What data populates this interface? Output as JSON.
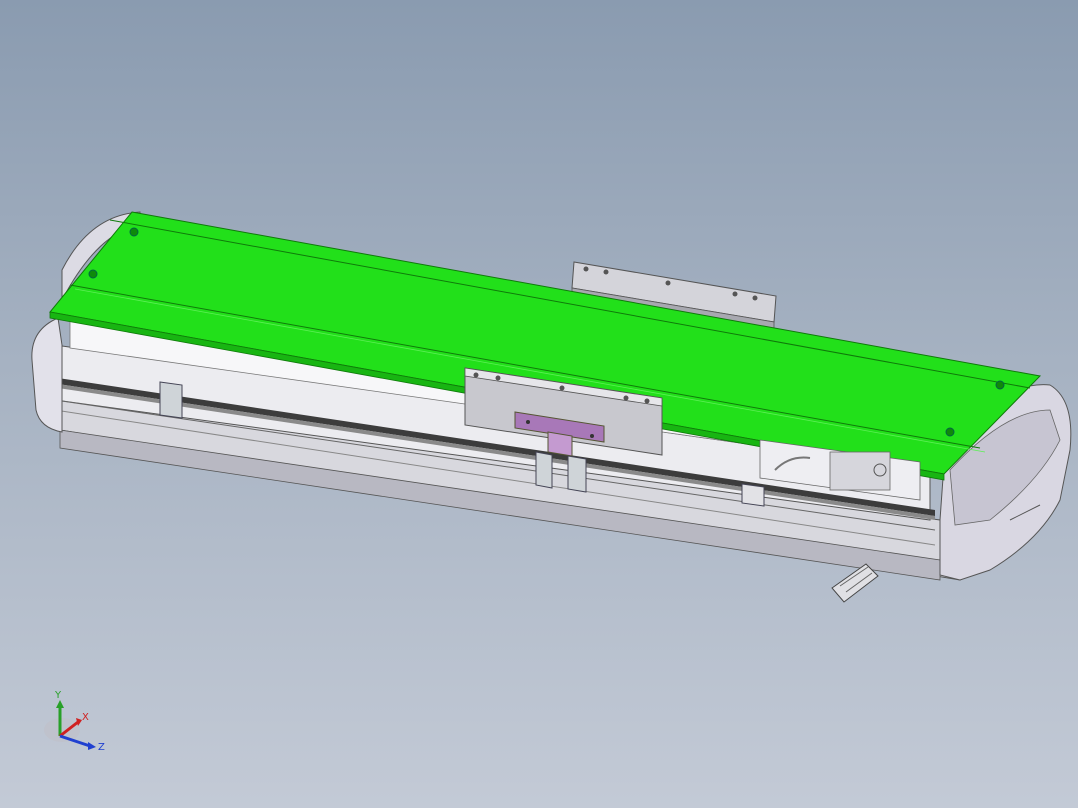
{
  "viewport": {
    "model_colors": {
      "top_cover": "#22e01a",
      "top_cover_edge": "#0f7a0a",
      "body": "#e4e4ea",
      "body_shadow": "#b4b4be",
      "end_cap": "#dedde6",
      "carriage": "#c9c9cf",
      "bracket": "#a878b8",
      "rail": "#3a3a3a"
    }
  },
  "triad": {
    "y_label": "Y",
    "x_label": "X",
    "z_label": "Z",
    "colors": {
      "y": "#28a028",
      "x": "#d02020",
      "z": "#2040d0"
    }
  }
}
